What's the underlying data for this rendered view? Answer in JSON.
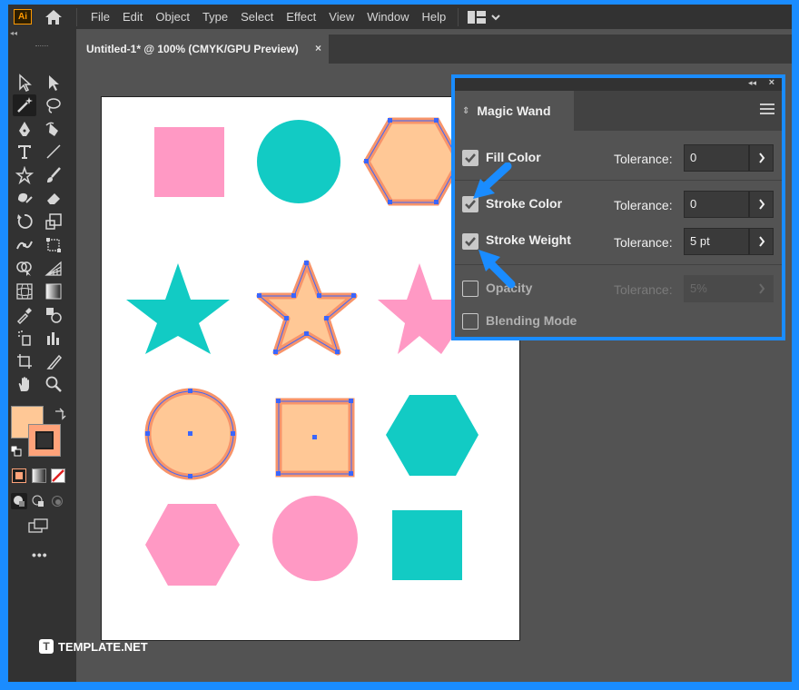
{
  "app": {
    "logo": "Ai",
    "menu": [
      "File",
      "Edit",
      "Object",
      "Type",
      "Select",
      "Effect",
      "View",
      "Window",
      "Help"
    ]
  },
  "toolbar_header": "◂◂",
  "document": {
    "tab_title": "Untitled-1* @ 100% (CMYK/GPU Preview)",
    "tab_close": "×"
  },
  "colors": {
    "pink": "#ff99c4",
    "teal": "#12cbc4",
    "peach_fill": "#ffc896",
    "peach_stroke": "#f7946a",
    "selection": "#3a66ff",
    "highlight": "#1a8cff"
  },
  "panel": {
    "title": "Magic Wand",
    "collapse": "◂◂",
    "close": "×",
    "options": [
      {
        "label": "Fill Color",
        "checked": true,
        "tolerance_label": "Tolerance:",
        "tolerance": "0",
        "enabled": true
      },
      {
        "label": "Stroke Color",
        "checked": true,
        "tolerance_label": "Tolerance:",
        "tolerance": "0",
        "enabled": true
      },
      {
        "label": "Stroke Weight",
        "checked": true,
        "tolerance_label": "Tolerance:",
        "tolerance": "5 pt",
        "enabled": true
      },
      {
        "label": "Opacity",
        "checked": false,
        "tolerance_label": "Tolerance:",
        "tolerance": "5%",
        "enabled": false
      },
      {
        "label": "Blending Mode",
        "checked": false,
        "enabled": false
      }
    ]
  },
  "watermark": {
    "logo": "T",
    "text": "TEMPLATE.NET"
  }
}
